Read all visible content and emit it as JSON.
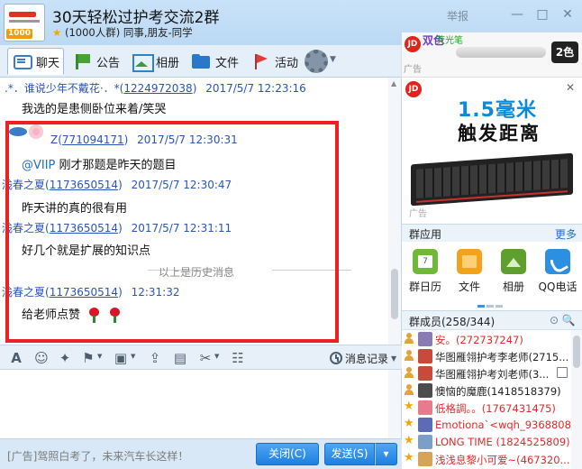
{
  "window": {
    "group_name": "30天轻松过护考交流2群",
    "group_info": "(1000人群) 同事,朋友-同学",
    "avatar_badge": "1000",
    "report_label": "举报",
    "min_symbol": "—",
    "max_symbol": "□",
    "close_symbol": "✕"
  },
  "tabs": [
    {
      "label": "聊天",
      "icon": "chat-icon",
      "active": true
    },
    {
      "label": "公告",
      "icon": "flag-icon"
    },
    {
      "label": "相册",
      "icon": "image-icon"
    },
    {
      "label": "文件",
      "icon": "folder-icon"
    },
    {
      "label": "活动",
      "icon": "red-flag-icon"
    }
  ],
  "chat": {
    "messages": [
      {
        "name": ".*．谁说少年不戴花·．*",
        "id": "1224972038",
        "time": "2017/5/7 12:23:16",
        "text": "我选的是患侧卧位来着/笑哭"
      },
      {
        "name": "Z",
        "id": "771094171",
        "time": "2017/5/7 12:30:31",
        "mention": "@VIIP",
        "text": "刚才那题是昨天的题目"
      },
      {
        "name": "浅春之夏",
        "id": "1173650514",
        "time": "2017/5/7 12:30:47",
        "text": "昨天讲的真的很有用"
      },
      {
        "name": "浅春之夏",
        "id": "1173650514",
        "time": "2017/5/7 12:31:11",
        "text": "好几个就是扩展的知识点"
      },
      {
        "name": "浅春之夏",
        "id": "1173650514",
        "time": "12:31:32",
        "text": "给老师点赞"
      }
    ],
    "history_divider": "以上是历史消息",
    "id_paren_open": "(",
    "id_paren_close": ")"
  },
  "toolbar": {
    "font_symbol": "A",
    "emoji_symbol": "☺",
    "screenshot_symbol": "✂",
    "history_label": "消息记录"
  },
  "bottom": {
    "ad_text": "[广告]驾照白考了，未来汽车长这样！",
    "close_label": "关闭(C)",
    "send_label": "发送(S)",
    "dropdown_symbol": "▾"
  },
  "ads": {
    "banner_jd": "JD",
    "banner_brand": "双色",
    "banner_brand2": "荧光笔",
    "banner_tag": "2色",
    "ad_label": "广告",
    "kb_title1": "1.5毫米",
    "kb_title2": "触发距离",
    "close_symbol": "✕"
  },
  "apps": {
    "title": "群应用",
    "more": "更多",
    "items": [
      {
        "label": "群日历",
        "icon": "calendar-icon"
      },
      {
        "label": "文件",
        "icon": "folder-icon"
      },
      {
        "label": "相册",
        "icon": "album-icon"
      },
      {
        "label": "QQ电话",
        "icon": "phone-icon"
      }
    ]
  },
  "members": {
    "title": "群成员(258/344)",
    "tools": "⊙ 🔍",
    "list": [
      {
        "name": "安。(272737247)",
        "style": "red",
        "rank": "user",
        "avatar_color": "#8a7bb5"
      },
      {
        "name": "华图雁翎护考李老师(2715...",
        "style": "dark",
        "rank": "user",
        "avatar_color": "#c74a3b"
      },
      {
        "name": "华图雁翎护考刘老师(3...",
        "style": "dark",
        "rank": "user",
        "avatar_color": "#c74a3b"
      },
      {
        "name": "懊恼的魔鹿(1418518379)",
        "style": "dark",
        "rank": "user",
        "avatar_color": "#4d4d4d"
      },
      {
        "name": "低格調。。(1767431475)",
        "style": "red",
        "rank": "star",
        "avatar_color": "#e77b8d"
      },
      {
        "name": "Emotiona`<wqh_93688089...",
        "style": "red",
        "rank": "star",
        "avatar_color": "#5d6ab5"
      },
      {
        "name": "LONG TIME (1824525809)",
        "style": "red",
        "rank": "star",
        "avatar_color": "#7aa0c8"
      },
      {
        "name": "浅浅息黎小可爱~(467320...",
        "style": "red",
        "rank": "star",
        "avatar_color": "#d6a35b"
      }
    ]
  }
}
